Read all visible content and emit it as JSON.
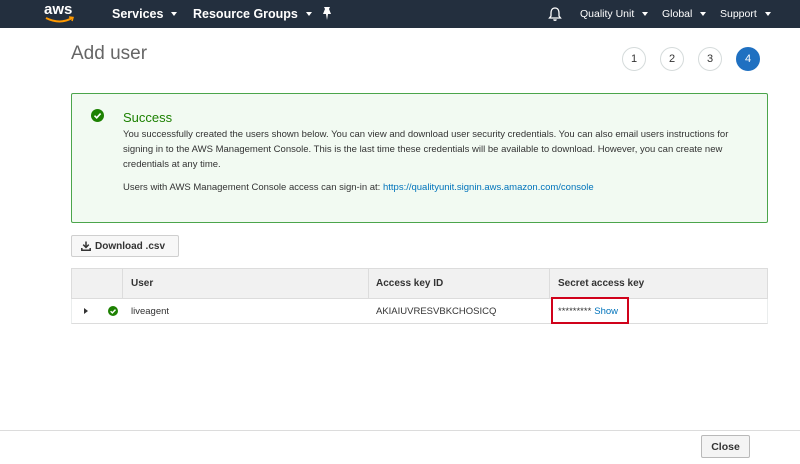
{
  "nav": {
    "logo": "aws",
    "services": "Services",
    "resource_groups": "Resource Groups",
    "account": "Quality Unit",
    "region": "Global",
    "support": "Support"
  },
  "page": {
    "title": "Add user",
    "steps": [
      "1",
      "2",
      "3",
      "4"
    ],
    "active_step": "4"
  },
  "success": {
    "title": "Success",
    "body": "You successfully created the users shown below. You can view and download user security credentials. You can also email users instructions for signing in to the AWS Management Console. This is the last time these credentials will be available to download. However, you can create new credentials at any time.",
    "signin_prefix": "Users with AWS Management Console access can sign-in at:",
    "signin_url": "https://qualityunit.signin.aws.amazon.com/console"
  },
  "download_label": "Download .csv",
  "table": {
    "headers": {
      "user": "User",
      "access_key_id": "Access key ID",
      "secret_access_key": "Secret access key"
    },
    "rows": [
      {
        "user": "liveagent",
        "access_key_id": "AKIAIUVRESVBKCHOSICQ",
        "secret_mask": "*********",
        "show_label": "Show"
      }
    ]
  },
  "footer": {
    "close_label": "Close"
  },
  "colors": {
    "nav_bg": "#232f3e",
    "accent": "#1f70c1",
    "success_green": "#1d8102",
    "link": "#0073bb",
    "highlight": "#d0021b"
  }
}
